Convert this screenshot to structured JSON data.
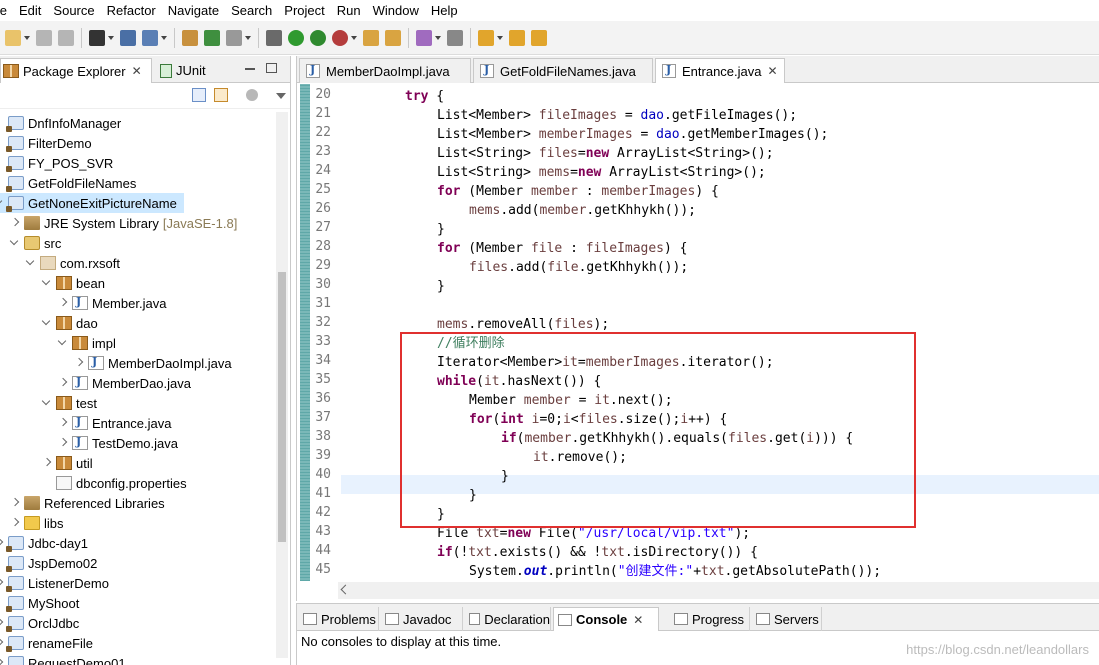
{
  "menu": [
    "ile",
    "Edit",
    "Source",
    "Refactor",
    "Navigate",
    "Search",
    "Project",
    "Run",
    "Window",
    "Help"
  ],
  "toolbar": {
    "icons": [
      "new-icon",
      "save-icon",
      "save-all-icon",
      "profile-icon",
      "console-icon",
      "debug-icon",
      "package-icon",
      "refresh-icon",
      "pin-icon",
      "bug-icon",
      "run-icon",
      "coverage-icon",
      "external-tools-icon",
      "open-folder-icon",
      "open-file-icon",
      "task-icon",
      "history-icon",
      "back-icon",
      "forward-icon",
      "pin-editor-icon"
    ]
  },
  "left_panel": {
    "tab_package_explorer": "Package Explorer",
    "tab_junit": "JUnit",
    "tree": [
      {
        "label": "DnfInfoManager",
        "type": "project",
        "indent": 0,
        "arrow": "none"
      },
      {
        "label": "FilterDemo",
        "type": "project",
        "indent": 0,
        "arrow": "none"
      },
      {
        "label": "FY_POS_SVR",
        "type": "project",
        "indent": 0,
        "arrow": "none"
      },
      {
        "label": "GetFoldFileNames",
        "type": "project",
        "indent": 0,
        "arrow": "none"
      },
      {
        "label": "GetNoneExitPictureName",
        "type": "project",
        "indent": 0,
        "arrow": "down",
        "selected": true
      },
      {
        "label": "JRE System Library",
        "suffix": "[JavaSE-1.8]",
        "type": "lib",
        "indent": 1,
        "arrow": "right"
      },
      {
        "label": "src",
        "type": "srcf",
        "indent": 1,
        "arrow": "down"
      },
      {
        "label": "com.rxsoft",
        "type": "pkge",
        "indent": 2,
        "arrow": "down"
      },
      {
        "label": "bean",
        "type": "pkg",
        "indent": 3,
        "arrow": "down"
      },
      {
        "label": "Member.java",
        "type": "java",
        "indent": 4,
        "arrow": "right"
      },
      {
        "label": "dao",
        "type": "pkg",
        "indent": 3,
        "arrow": "down"
      },
      {
        "label": "impl",
        "type": "pkg",
        "indent": 4,
        "arrow": "down"
      },
      {
        "label": "MemberDaoImpl.java",
        "type": "java",
        "indent": 5,
        "arrow": "right"
      },
      {
        "label": "MemberDao.java",
        "type": "java",
        "indent": 4,
        "arrow": "right"
      },
      {
        "label": "test",
        "type": "pkg",
        "indent": 3,
        "arrow": "down"
      },
      {
        "label": "Entrance.java",
        "type": "java",
        "indent": 4,
        "arrow": "right"
      },
      {
        "label": "TestDemo.java",
        "type": "java",
        "indent": 4,
        "arrow": "right"
      },
      {
        "label": "util",
        "type": "pkg",
        "indent": 3,
        "arrow": "right"
      },
      {
        "label": "dbconfig.properties",
        "type": "props",
        "indent": 3,
        "arrow": "none"
      },
      {
        "label": "Referenced Libraries",
        "type": "lib",
        "indent": 1,
        "arrow": "right"
      },
      {
        "label": "libs",
        "type": "fold",
        "indent": 1,
        "arrow": "right"
      },
      {
        "label": "Jdbc-day1",
        "type": "project",
        "indent": 0,
        "arrow": "right"
      },
      {
        "label": "JspDemo02",
        "type": "project",
        "indent": 0,
        "arrow": "none"
      },
      {
        "label": "ListenerDemo",
        "type": "project",
        "indent": 0,
        "arrow": "right"
      },
      {
        "label": "MyShoot",
        "type": "project",
        "indent": 0,
        "arrow": "none"
      },
      {
        "label": "OrclJdbc",
        "type": "project",
        "indent": 0,
        "arrow": "right"
      },
      {
        "label": "renameFile",
        "type": "project",
        "indent": 0,
        "arrow": "right"
      },
      {
        "label": "RequestDemo01",
        "type": "project",
        "indent": 0,
        "arrow": "right"
      }
    ]
  },
  "editor": {
    "tabs": [
      "MemberDaoImpl.java",
      "GetFoldFileNames.java",
      "Entrance.java"
    ],
    "active_tab": "Entrance.java",
    "line_numbers": [
      "20",
      "21",
      "22",
      "23",
      "24",
      "25",
      "26",
      "27",
      "28",
      "29",
      "30",
      "31",
      "32",
      "33",
      "34",
      "35",
      "36",
      "37",
      "38",
      "39",
      "40",
      "41",
      "42",
      "43",
      "44",
      "45"
    ],
    "annotation_color": "#e0302f"
  },
  "bottom_panel": {
    "tabs": [
      "Problems",
      "Javadoc",
      "Declaration",
      "Console",
      "Progress",
      "Servers"
    ],
    "active_tab": "Console",
    "message": "No consoles to display at this time.",
    "watermark": "https://blog.csdn.net/leandollars"
  }
}
